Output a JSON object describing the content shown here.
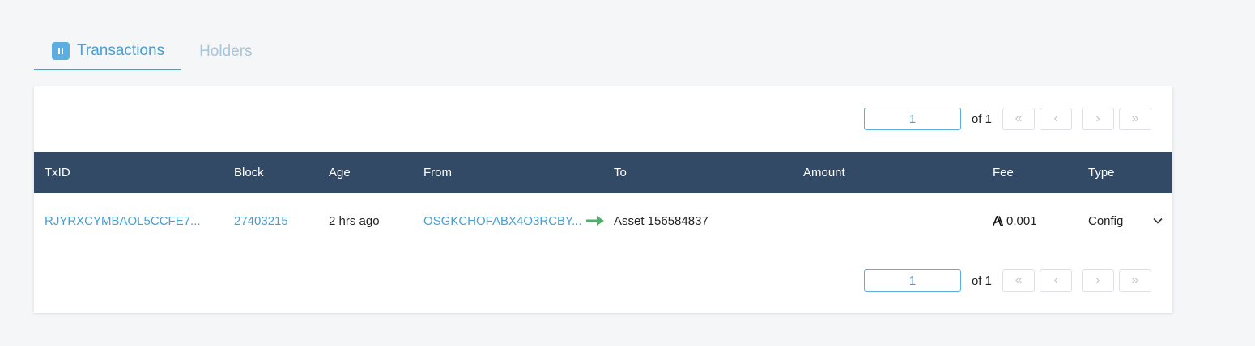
{
  "tabs": [
    {
      "label": "Transactions",
      "active": true
    },
    {
      "label": "Holders",
      "active": false
    }
  ],
  "pagination": {
    "current_page": "1",
    "of_label": "of 1",
    "first_icon": "«",
    "prev_icon": "‹",
    "next_icon": "›",
    "last_icon": "»"
  },
  "table": {
    "columns": [
      "TxID",
      "Block",
      "Age",
      "From",
      "To",
      "Amount",
      "Fee",
      "Type"
    ],
    "rows": [
      {
        "txid": "RJYRXCYMBAOL5CCFE7...",
        "block": "27403215",
        "age": "2 hrs ago",
        "from": "OSGKCHOFABX4O3RCBY...",
        "to": "Asset 156584837",
        "amount": "",
        "fee": "0.001",
        "type": "Config"
      }
    ]
  },
  "colors": {
    "accent": "#4a9fd1",
    "header_bg": "#324a66",
    "arrow_green": "#4caf6a"
  },
  "icons": {
    "pause": "pause-icon",
    "transfer": "arrow-right-icon",
    "algo": "algo-icon",
    "expand": "chevron-down-icon"
  }
}
